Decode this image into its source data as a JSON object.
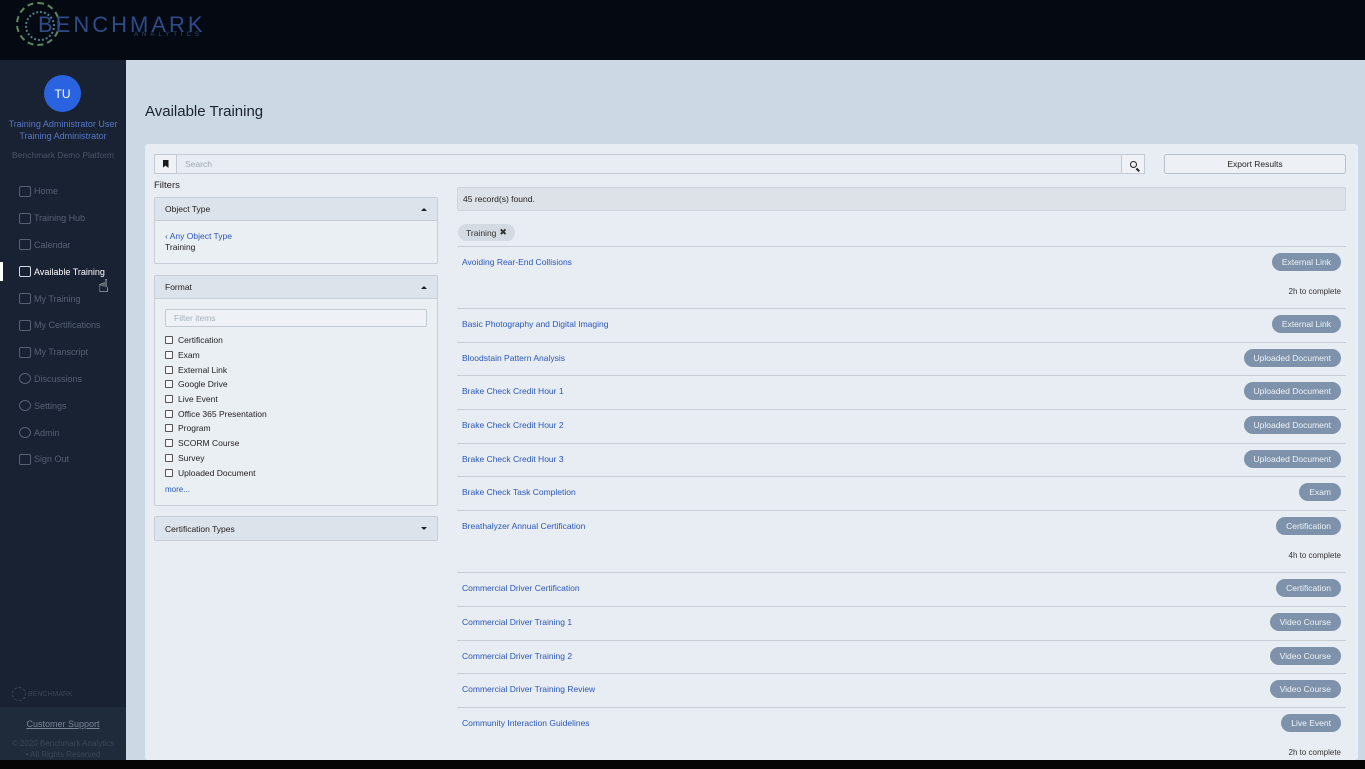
{
  "brand": {
    "name": "BENCHMARK",
    "sub": "ANALYTICS"
  },
  "user": {
    "initials": "TU",
    "name": "Training Administrator User",
    "role": "Training Administrator",
    "platform": "Benchmark Demo Platform"
  },
  "sidebar": {
    "items": [
      {
        "label": "Home",
        "icon": "home-icon"
      },
      {
        "label": "Training Hub",
        "icon": "training-hub-icon"
      },
      {
        "label": "Calendar",
        "icon": "calendar-icon"
      },
      {
        "label": "Available Training",
        "icon": "available-training-icon",
        "active": true
      },
      {
        "label": "My Training",
        "icon": "my-training-icon"
      },
      {
        "label": "My Certifications",
        "icon": "certifications-icon"
      },
      {
        "label": "My Transcript",
        "icon": "transcript-icon"
      },
      {
        "label": "Discussions",
        "icon": "discussions-icon"
      },
      {
        "label": "Settings",
        "icon": "gear-icon"
      },
      {
        "label": "Admin",
        "icon": "key-icon"
      },
      {
        "label": "Sign Out",
        "icon": "sign-out-icon"
      }
    ],
    "footer_logo": "BENCHMARK",
    "support": "Customer Support",
    "copyright1": "© 2020 Benchmark Analytics",
    "copyright2": "• All Rights Reserved"
  },
  "main": {
    "title": "Available Training",
    "search_placeholder": "Search",
    "export_label": "Export Results",
    "filters_label": "Filters",
    "object_type": {
      "title": "Object Type",
      "any_label": "Any Object Type",
      "selected": "Training"
    },
    "format": {
      "title": "Format",
      "filter_placeholder": "Filter items",
      "options": [
        "Certification",
        "Exam",
        "External Link",
        "Google Drive",
        "Live Event",
        "Office 365 Presentation",
        "Program",
        "SCORM Course",
        "Survey",
        "Uploaded Document"
      ],
      "more": "more..."
    },
    "certification_types": {
      "title": "Certification Types"
    },
    "records_found": "45 record(s) found.",
    "active_chip": "Training",
    "results": [
      {
        "title": "Avoiding Rear-End Collisions",
        "type": "External Link",
        "duration": "2h to complete"
      },
      {
        "title": "Basic Photography and Digital Imaging",
        "type": "External Link"
      },
      {
        "title": "Bloodstain Pattern Analysis",
        "type": "Uploaded Document"
      },
      {
        "title": "Brake Check Credit Hour 1",
        "type": "Uploaded Document"
      },
      {
        "title": "Brake Check Credit Hour 2",
        "type": "Uploaded Document"
      },
      {
        "title": "Brake Check Credit Hour 3",
        "type": "Uploaded Document"
      },
      {
        "title": "Brake Check Task Completion",
        "type": "Exam"
      },
      {
        "title": "Breathalyzer Annual Certification",
        "type": "Certification",
        "duration": "4h to complete"
      },
      {
        "title": "Commercial Driver Certification",
        "type": "Certification"
      },
      {
        "title": "Commercial Driver Training 1",
        "type": "Video Course"
      },
      {
        "title": "Commercial Driver Training 2",
        "type": "Video Course"
      },
      {
        "title": "Commercial Driver Training Review",
        "type": "Video Course"
      },
      {
        "title": "Community Interaction Guidelines",
        "type": "Live Event",
        "duration": "2h to complete"
      }
    ]
  },
  "colors": {
    "accent": "#2a63e0",
    "link": "#2a57b8",
    "badge": "#7e93ab",
    "sidebar": "#182233"
  }
}
